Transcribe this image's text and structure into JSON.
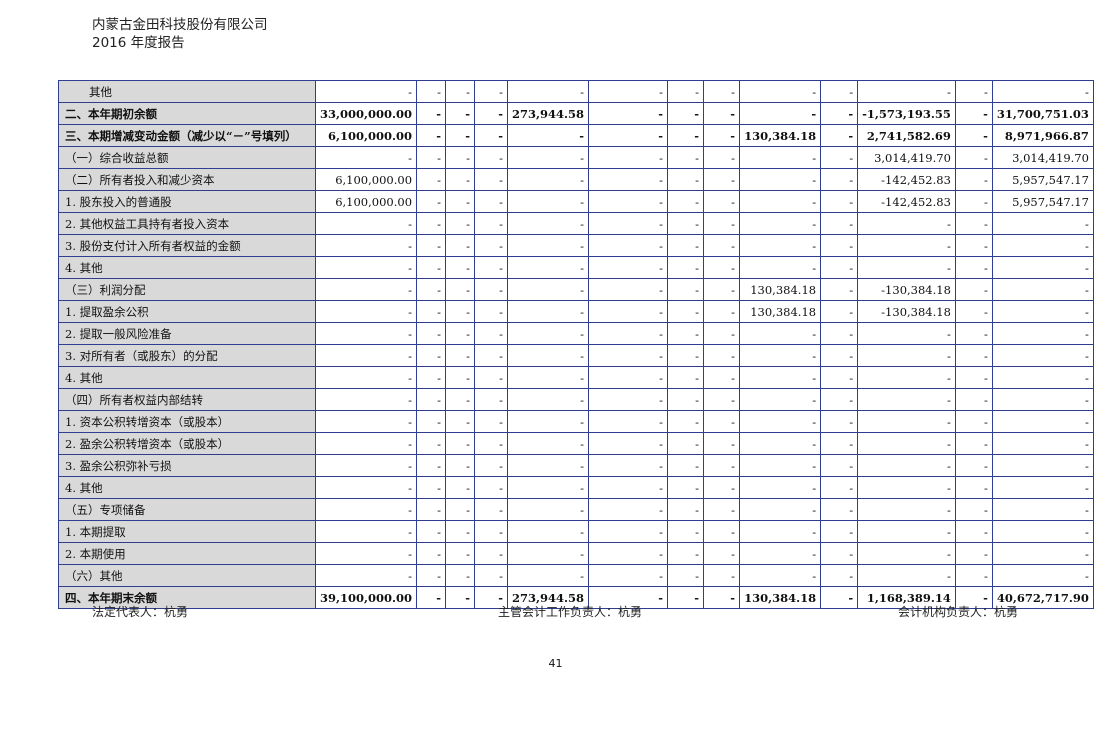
{
  "header": {
    "company": "内蒙古金田科技股份有限公司",
    "report": "2016 年度报告"
  },
  "table": {
    "rows": [
      {
        "label": "其他",
        "indent": true,
        "bold": false,
        "cells": [
          "-",
          "-",
          "-",
          "-",
          "-",
          "-",
          "-",
          "-",
          "-",
          "-",
          "-",
          "-",
          "-"
        ]
      },
      {
        "label": "二、本年期初余额",
        "indent": false,
        "bold": true,
        "cells": [
          "33,000,000.00",
          "-",
          "-",
          "-",
          "273,944.58",
          "-",
          "-",
          "-",
          "-",
          "-",
          "-1,573,193.55",
          "-",
          "31,700,751.03"
        ]
      },
      {
        "label": "三、本期增减变动金额（减少以“－”号填列）",
        "indent": false,
        "bold": true,
        "cells": [
          "6,100,000.00",
          "-",
          "-",
          "-",
          "-",
          "-",
          "-",
          "-",
          "130,384.18",
          "-",
          "2,741,582.69",
          "-",
          "8,971,966.87"
        ]
      },
      {
        "label": "（一）综合收益总额",
        "indent": false,
        "bold": false,
        "cells": [
          "-",
          "-",
          "-",
          "-",
          "-",
          "-",
          "-",
          "-",
          "-",
          "-",
          "3,014,419.70",
          "-",
          "3,014,419.70"
        ]
      },
      {
        "label": "（二）所有者投入和减少资本",
        "indent": false,
        "bold": false,
        "cells": [
          "6,100,000.00",
          "-",
          "-",
          "-",
          "-",
          "-",
          "-",
          "-",
          "-",
          "-",
          "-142,452.83",
          "-",
          "5,957,547.17"
        ]
      },
      {
        "label": "1. 股东投入的普通股",
        "indent": false,
        "bold": false,
        "cells": [
          "6,100,000.00",
          "-",
          "-",
          "-",
          "-",
          "-",
          "-",
          "-",
          "-",
          "-",
          "-142,452.83",
          "-",
          "5,957,547.17"
        ]
      },
      {
        "label": "2. 其他权益工具持有者投入资本",
        "indent": false,
        "bold": false,
        "cells": [
          "-",
          "-",
          "-",
          "-",
          "-",
          "-",
          "-",
          "-",
          "-",
          "-",
          "-",
          "-",
          "-"
        ]
      },
      {
        "label": "3. 股份支付计入所有者权益的金额",
        "indent": false,
        "bold": false,
        "cells": [
          "-",
          "-",
          "-",
          "-",
          "-",
          "-",
          "-",
          "-",
          "-",
          "-",
          "-",
          "-",
          "-"
        ]
      },
      {
        "label": "4. 其他",
        "indent": false,
        "bold": false,
        "cells": [
          "-",
          "-",
          "-",
          "-",
          "-",
          "-",
          "-",
          "-",
          "-",
          "-",
          "-",
          "-",
          "-"
        ]
      },
      {
        "label": "（三）利润分配",
        "indent": false,
        "bold": false,
        "cells": [
          "-",
          "-",
          "-",
          "-",
          "-",
          "-",
          "-",
          "-",
          "130,384.18",
          "-",
          "-130,384.18",
          "-",
          "-"
        ]
      },
      {
        "label": "1. 提取盈余公积",
        "indent": false,
        "bold": false,
        "cells": [
          "-",
          "-",
          "-",
          "-",
          "-",
          "-",
          "-",
          "-",
          "130,384.18",
          "-",
          "-130,384.18",
          "-",
          "-"
        ]
      },
      {
        "label": "2. 提取一般风险准备",
        "indent": false,
        "bold": false,
        "cells": [
          "-",
          "-",
          "-",
          "-",
          "-",
          "-",
          "-",
          "-",
          "-",
          "-",
          "-",
          "-",
          "-"
        ]
      },
      {
        "label": "3. 对所有者（或股东）的分配",
        "indent": false,
        "bold": false,
        "cells": [
          "-",
          "-",
          "-",
          "-",
          "-",
          "-",
          "-",
          "-",
          "-",
          "-",
          "-",
          "-",
          "-"
        ]
      },
      {
        "label": "4. 其他",
        "indent": false,
        "bold": false,
        "cells": [
          "-",
          "-",
          "-",
          "-",
          "-",
          "-",
          "-",
          "-",
          "-",
          "-",
          "-",
          "-",
          "-"
        ]
      },
      {
        "label": "（四）所有者权益内部结转",
        "indent": false,
        "bold": false,
        "cells": [
          "-",
          "-",
          "-",
          "-",
          "-",
          "-",
          "-",
          "-",
          "-",
          "-",
          "-",
          "-",
          "-"
        ]
      },
      {
        "label": "1. 资本公积转增资本（或股本）",
        "indent": false,
        "bold": false,
        "cells": [
          "-",
          "-",
          "-",
          "-",
          "-",
          "-",
          "-",
          "-",
          "-",
          "-",
          "-",
          "-",
          "-"
        ]
      },
      {
        "label": "2. 盈余公积转增资本（或股本）",
        "indent": false,
        "bold": false,
        "cells": [
          "-",
          "-",
          "-",
          "-",
          "-",
          "-",
          "-",
          "-",
          "-",
          "-",
          "-",
          "-",
          "-"
        ]
      },
      {
        "label": "3. 盈余公积弥补亏损",
        "indent": false,
        "bold": false,
        "cells": [
          "-",
          "-",
          "-",
          "-",
          "-",
          "-",
          "-",
          "-",
          "-",
          "-",
          "-",
          "-",
          "-"
        ]
      },
      {
        "label": "4. 其他",
        "indent": false,
        "bold": false,
        "cells": [
          "-",
          "-",
          "-",
          "-",
          "-",
          "-",
          "-",
          "-",
          "-",
          "-",
          "-",
          "-",
          "-"
        ]
      },
      {
        "label": "（五）专项储备",
        "indent": false,
        "bold": false,
        "cells": [
          "-",
          "-",
          "-",
          "-",
          "-",
          "-",
          "-",
          "-",
          "-",
          "-",
          "-",
          "-",
          "-"
        ]
      },
      {
        "label": "1. 本期提取",
        "indent": false,
        "bold": false,
        "cells": [
          "-",
          "-",
          "-",
          "-",
          "-",
          "-",
          "-",
          "-",
          "-",
          "-",
          "-",
          "-",
          "-"
        ]
      },
      {
        "label": "2. 本期使用",
        "indent": false,
        "bold": false,
        "cells": [
          "-",
          "-",
          "-",
          "-",
          "-",
          "-",
          "-",
          "-",
          "-",
          "-",
          "-",
          "-",
          "-"
        ]
      },
      {
        "label": "（六）其他",
        "indent": false,
        "bold": false,
        "cells": [
          "-",
          "-",
          "-",
          "-",
          "-",
          "-",
          "-",
          "-",
          "-",
          "-",
          "-",
          "-",
          "-"
        ]
      },
      {
        "label": "四、本年期末余额",
        "indent": false,
        "bold": true,
        "cells": [
          "39,100,000.00",
          "-",
          "-",
          "-",
          "273,944.58",
          "-",
          "-",
          "-",
          "130,384.18",
          "-",
          "1,168,389.14",
          "-",
          "40,672,717.90"
        ]
      }
    ]
  },
  "footer": {
    "legal_rep": "法定代表人：杭勇",
    "accounting_head": "主管会计工作负责人：杭勇",
    "accounting_org_head": "会计机构负责人：杭勇",
    "page_number": "41"
  }
}
